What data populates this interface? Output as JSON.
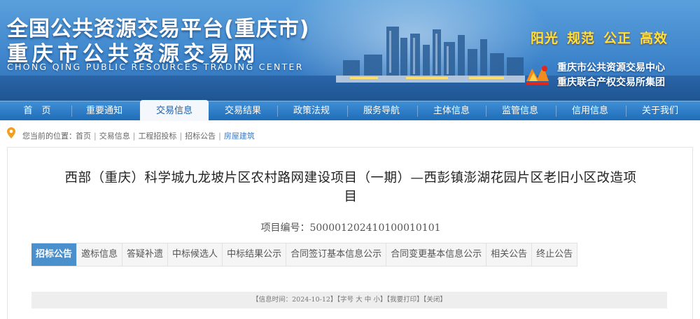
{
  "header": {
    "title_main": "全国公共资源交易平台(重庆市)",
    "title_sub": "重庆市公共资源交易网",
    "title_en": "CHONG QING PUBLIC RESOURCES TRADING CENTER",
    "slogans": [
      "阳光",
      "规范",
      "公正",
      "高效"
    ],
    "org_line1": "重庆市公共资源交易中心",
    "org_line2": "重庆联合产权交易所集团",
    "colors": {
      "banner": "#3f86cc",
      "slogan": "#ffe23a",
      "nav": "#2a7cc6",
      "tab_active": "#4a90cc"
    }
  },
  "nav": {
    "items": [
      "首　页",
      "重要通知",
      "交易信息",
      "交易结果",
      "政策法规",
      "服务导航",
      "主体信息",
      "监管信息",
      "信用信息",
      "关于我们"
    ],
    "active": "交易信息"
  },
  "breadcrumb": {
    "icon": "location-pin-icon",
    "prefix": "您当前的位置：",
    "items": [
      "首页",
      "交易信息",
      "工程招投标",
      "招标公告",
      "房屋建筑"
    ]
  },
  "project": {
    "title_line1": "西部（重庆）科学城九龙坡片区农村路网建设项目（一期）—西彭镇澎湖花园片区老旧小区改造项",
    "title_line2": "目",
    "number_label": "项目编号：",
    "number": "500001202410100010101"
  },
  "tabs": {
    "items": [
      "招标公告",
      "邀标信息",
      "答疑补遗",
      "中标候选人",
      "中标结果公示",
      "合同签订基本信息公示",
      "合同变更基本信息公示",
      "相关公告",
      "终止公告"
    ],
    "active": "招标公告"
  },
  "infobar": {
    "time_label": "【信息时间：",
    "time": "2024-10-12",
    "font_label": "】【字号",
    "size_big": "大",
    "size_mid": "中",
    "size_small": "小",
    "print": "】【我要打印】",
    "close": "【关闭】"
  }
}
